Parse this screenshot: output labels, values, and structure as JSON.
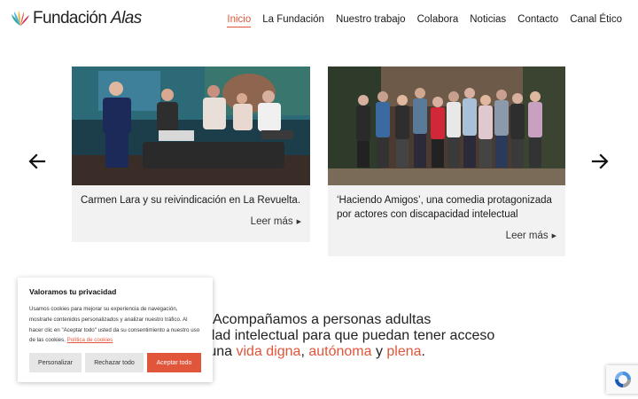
{
  "brand": {
    "name_part1": "Fundación",
    "name_part2": "Alas",
    "accent": "#e1553b"
  },
  "nav": {
    "items": [
      {
        "label": "Inicio",
        "active": true
      },
      {
        "label": "La Fundación"
      },
      {
        "label": "Nuestro trabajo"
      },
      {
        "label": "Colabora"
      },
      {
        "label": "Noticias"
      },
      {
        "label": "Contacto"
      },
      {
        "label": "Canal Ético"
      }
    ]
  },
  "carousel": {
    "prev_icon": "arrow-left-icon",
    "next_icon": "arrow-right-icon",
    "cards": [
      {
        "title": "Carmen Lara y su reivindicación en La Revuelta.",
        "link": "Leer más"
      },
      {
        "title": "‘Haciendo Amigos’, una comedia protagonizada por actores con discapacidad intelectual",
        "link": "Leer más"
      }
    ]
  },
  "mission": {
    "line1": "Acompañamos a personas adultas",
    "line2": "cidad intelectual para que puedan tener acceso",
    "line3_prefix": "a una ",
    "hl1": "vida digna",
    "sep1": ", ",
    "hl2": "autónoma",
    "sep2": " y ",
    "hl3": "plena",
    "end": "."
  },
  "cookie": {
    "title": "Valoramos tu privacidad",
    "body": "Usamos cookies para mejorar su experiencia de navegación, mostrarle contenidos personalizados y analizar nuestro tráfico. Al hacer clic en \"Aceptar todo\" usted da su consentimiento a nuestro uso de las cookies.",
    "link": "Política de cookies",
    "btn_customize": "Personalizar",
    "btn_reject": "Rechazar todo",
    "btn_accept": "Aceptar todo"
  },
  "recaptcha": {
    "icon": "recaptcha-icon"
  }
}
